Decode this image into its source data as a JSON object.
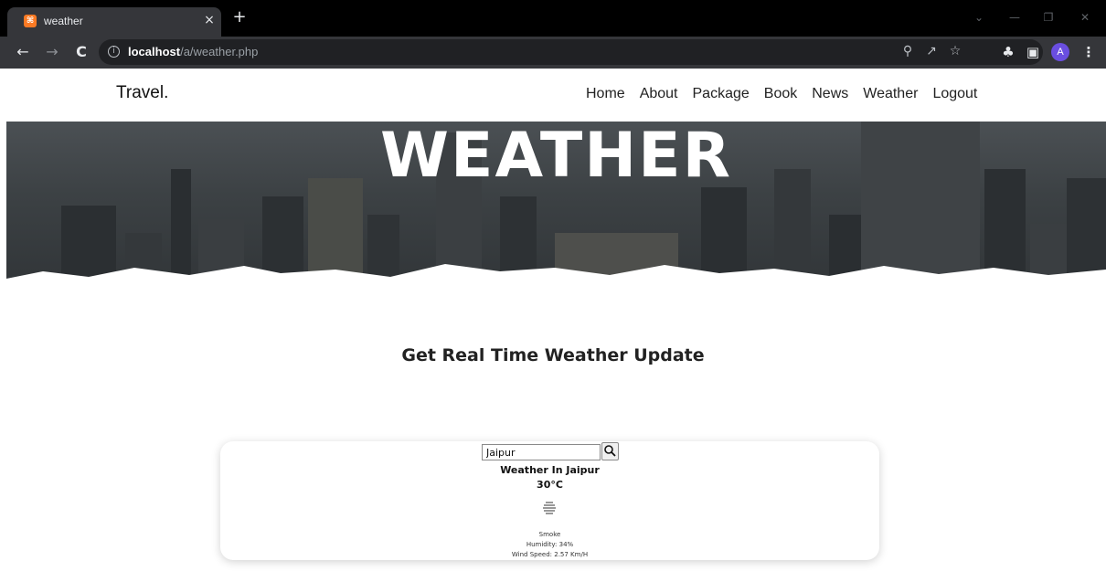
{
  "browser": {
    "tab_title": "weather",
    "favicon_glyph": "⌘",
    "close_glyph": "×",
    "new_tab_glyph": "+",
    "url_host": "localhost",
    "url_path": "/a/weather.php",
    "avatar_letter": "A",
    "accent_color": "#6a4ee0"
  },
  "site": {
    "logo": "Travel.",
    "nav": [
      "Home",
      "About",
      "Package",
      "Book",
      "News",
      "Weather",
      "Logout"
    ]
  },
  "hero": {
    "title": "WEATHER"
  },
  "main": {
    "subtitle": "Get Real Time Weather Update",
    "search_value": "Jaipur",
    "heading": "Weather In Jaipur",
    "temperature": "30°C",
    "icon": "smoke-haze-icon",
    "description": "Smoke",
    "humidity": "Humidity: 34%",
    "wind": "Wind Speed: 2.57 Km/H"
  }
}
